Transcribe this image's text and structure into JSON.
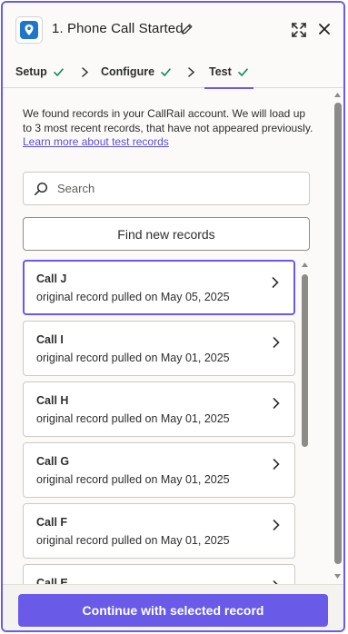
{
  "header": {
    "title": "1. Phone Call Started",
    "app_icon": "callrail-pin-icon",
    "icons": [
      "pencil-icon",
      "expand-icon",
      "close-icon"
    ]
  },
  "steps": [
    {
      "label": "Setup",
      "complete": true
    },
    {
      "label": "Configure",
      "complete": true
    },
    {
      "label": "Test",
      "complete": true,
      "active": true
    }
  ],
  "intro": {
    "text": "We found records in your CallRail account. We will load up to 3 most recent records, that have not appeared previously.",
    "link": "Learn more about test records"
  },
  "search": {
    "placeholder": "Search",
    "value": ""
  },
  "find_button": "Find new records",
  "records": [
    {
      "name": "Call J",
      "subtitle": "original record pulled on May 05, 2025",
      "selected": true
    },
    {
      "name": "Call I",
      "subtitle": "original record pulled on May 01, 2025",
      "selected": false
    },
    {
      "name": "Call H",
      "subtitle": "original record pulled on May 01, 2025",
      "selected": false
    },
    {
      "name": "Call G",
      "subtitle": "original record pulled on May 01, 2025",
      "selected": false
    },
    {
      "name": "Call F",
      "subtitle": "original record pulled on May 01, 2025",
      "selected": false
    },
    {
      "name": "Call E",
      "subtitle": "",
      "selected": false
    }
  ],
  "footer": {
    "cta": "Continue with selected record"
  },
  "colors": {
    "accent": "#695be8",
    "success": "#138a5b",
    "brand_icon": "#1f76c9"
  }
}
